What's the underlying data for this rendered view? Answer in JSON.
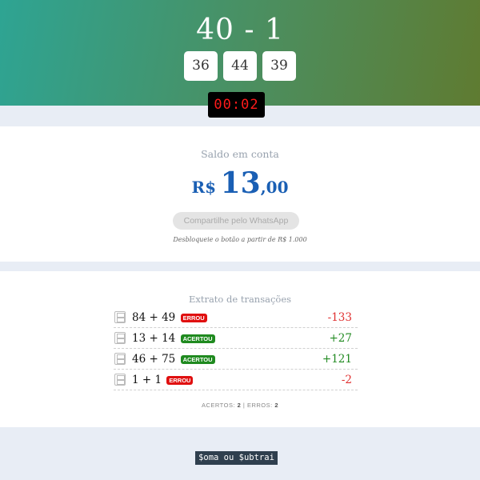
{
  "game": {
    "question": "40 - 1",
    "options": [
      "36",
      "44",
      "39"
    ],
    "timer": "00:02"
  },
  "balance": {
    "title": "Saldo em conta",
    "currency": "R$",
    "integer": "13",
    "decimal": ",00",
    "share_button": "Compartilhe pelo WhatsApp",
    "unlock_note": "Desbloqueie o botão a partir de R$ 1.000"
  },
  "transactions": {
    "title": "Extrato de transações",
    "rows": [
      {
        "expr": "84 + 49",
        "status": "ERROU",
        "value": "-133"
      },
      {
        "expr": "13 + 14",
        "status": "ACERTOU",
        "value": "+27"
      },
      {
        "expr": "46 + 75",
        "status": "ACERTOU",
        "value": "+121"
      },
      {
        "expr": "1 + 1",
        "status": "ERROU",
        "value": "-2"
      }
    ],
    "summary": {
      "hits_label": "ACERTOS:",
      "hits": "2",
      "separator": "|",
      "errors_label": "ERROS:",
      "errors": "2"
    }
  },
  "footer": {
    "label": "$oma ou $ubtrai"
  },
  "colors": {
    "brand_blue": "#1a5fb4",
    "error": "#e01010",
    "success": "#1f8a1f",
    "timer_red": "#ff1a1a"
  },
  "icons": {
    "transaction": "calculator-icon"
  }
}
